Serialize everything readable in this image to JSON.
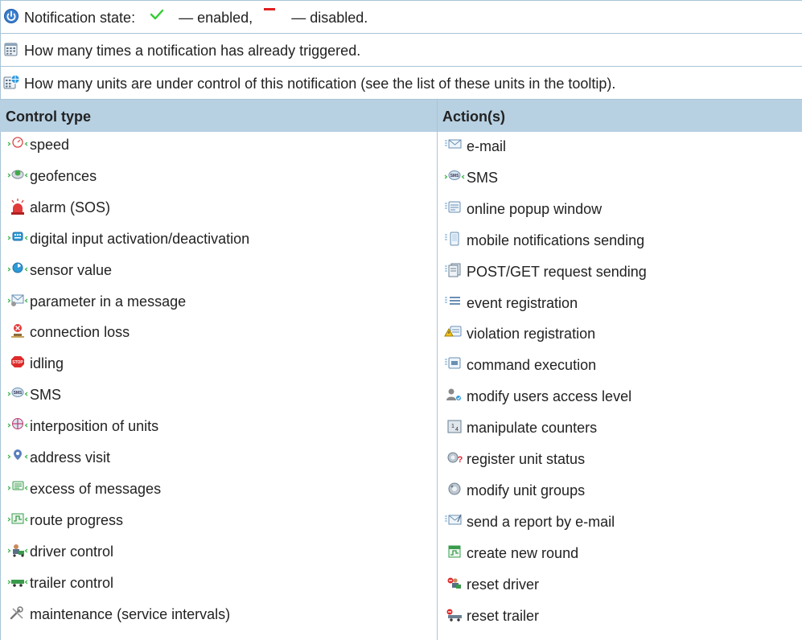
{
  "legend": {
    "state_prefix": "Notification state:",
    "state_enabled": "— enabled,",
    "state_disabled": "— disabled.",
    "triggered": "How many times a notification has already triggered.",
    "units": "How many units are under control of this notification (see the list of these units in the tooltip)."
  },
  "table": {
    "headers": {
      "control": "Control type",
      "action": "Action(s)"
    },
    "control_types": [
      {
        "label": "speed",
        "icon": "speedometer-icon"
      },
      {
        "label": "geofences",
        "icon": "geofence-icon"
      },
      {
        "label": "alarm (SOS)",
        "icon": "alarm-icon"
      },
      {
        "label": "digital input activation/deactivation",
        "icon": "digital-input-icon"
      },
      {
        "label": "sensor value",
        "icon": "sensor-icon"
      },
      {
        "label": "parameter in a message",
        "icon": "message-parameter-icon"
      },
      {
        "label": "connection loss",
        "icon": "connection-loss-icon"
      },
      {
        "label": "idling",
        "icon": "stop-sign-icon"
      },
      {
        "label": "SMS",
        "icon": "sms-icon"
      },
      {
        "label": "interposition of units",
        "icon": "interposition-icon"
      },
      {
        "label": "address visit",
        "icon": "address-pin-icon"
      },
      {
        "label": "excess of messages",
        "icon": "messages-excess-icon"
      },
      {
        "label": "route progress",
        "icon": "route-icon"
      },
      {
        "label": "driver control",
        "icon": "driver-icon"
      },
      {
        "label": "trailer control",
        "icon": "trailer-icon"
      },
      {
        "label": "maintenance (service intervals)",
        "icon": "wrench-icon"
      }
    ],
    "actions": [
      {
        "label": "e-mail",
        "icon": "email-icon"
      },
      {
        "label": "SMS",
        "icon": "sms-icon"
      },
      {
        "label": "online popup window",
        "icon": "popup-window-icon"
      },
      {
        "label": "mobile notifications sending",
        "icon": "mobile-icon"
      },
      {
        "label": "POST/GET request sending",
        "icon": "request-icon"
      },
      {
        "label": "event registration",
        "icon": "event-icon"
      },
      {
        "label": "violation registration",
        "icon": "violation-icon"
      },
      {
        "label": "command execution",
        "icon": "command-icon"
      },
      {
        "label": "modify users access level",
        "icon": "user-access-icon"
      },
      {
        "label": "manipulate counters",
        "icon": "counters-icon"
      },
      {
        "label": "register unit status",
        "icon": "unit-status-icon"
      },
      {
        "label": "modify unit groups",
        "icon": "unit-groups-icon"
      },
      {
        "label": "send a report by e-mail",
        "icon": "report-email-icon"
      },
      {
        "label": "create new round",
        "icon": "new-round-icon"
      },
      {
        "label": "reset driver",
        "icon": "reset-driver-icon"
      },
      {
        "label": "reset trailer",
        "icon": "reset-trailer-icon"
      }
    ]
  },
  "colors": {
    "border": "#a9c4d6",
    "header_bg": "#b7d0e2",
    "enabled": "#33cc33",
    "disabled": "#e02020"
  }
}
